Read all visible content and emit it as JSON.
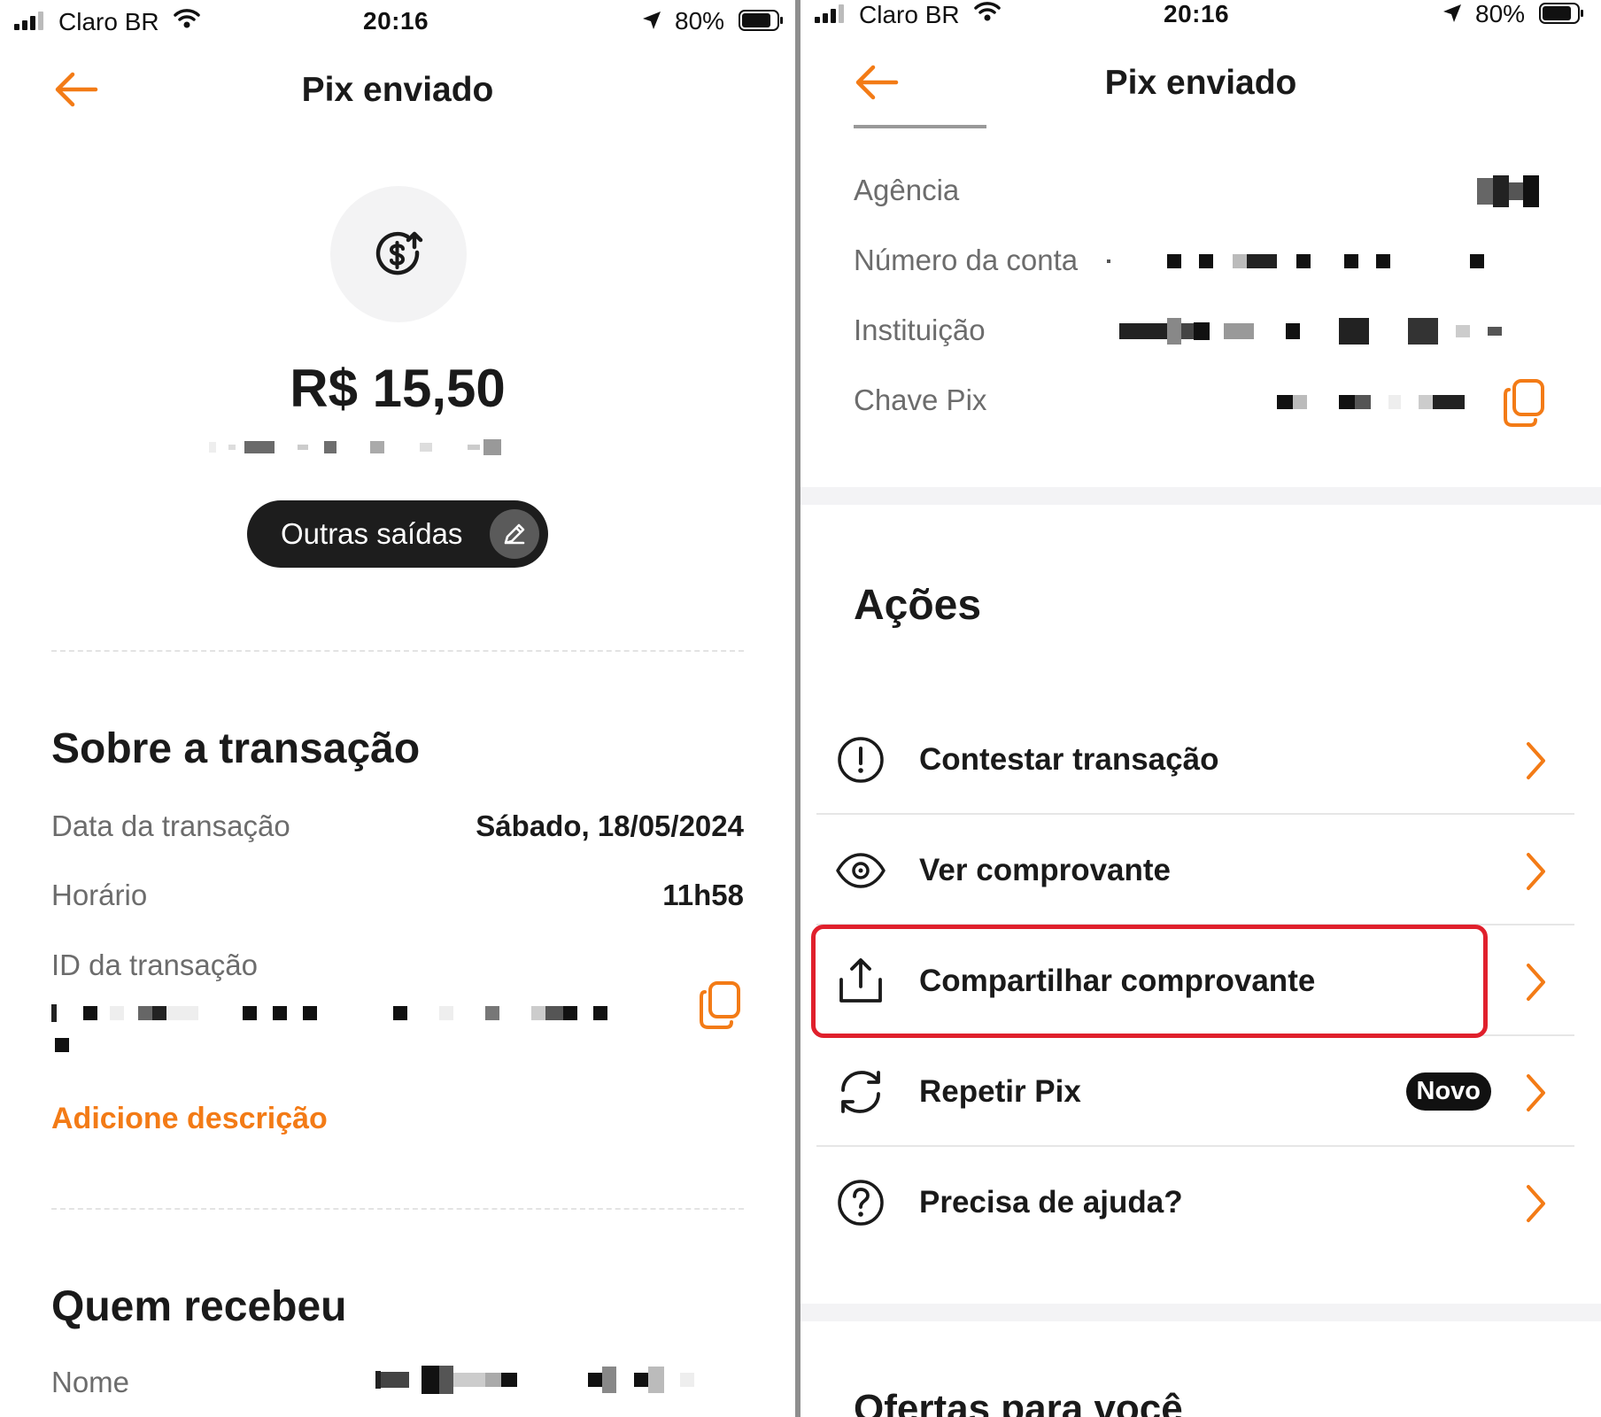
{
  "status_bar": {
    "carrier": "Claro BR",
    "time": "20:16",
    "battery": "80%"
  },
  "left": {
    "title": "Pix enviado",
    "amount": "R$ 15,50",
    "category_pill": "Outras saídas",
    "section_transaction": "Sobre a transação",
    "rows": {
      "date_label": "Data da transação",
      "date_value": "Sábado, 18/05/2024",
      "time_label": "Horário",
      "time_value": "11h58",
      "id_label": "ID da transação"
    },
    "add_description": "Adicione descrição",
    "section_receiver": "Quem recebeu",
    "name_label": "Nome"
  },
  "right": {
    "title": "Pix enviado",
    "rows": {
      "agency_label": "Agência",
      "account_label": "Número da conta",
      "institution_label": "Instituição",
      "pix_key_label": "Chave Pix"
    },
    "section_actions": "Ações",
    "actions": [
      {
        "label": "Contestar transação",
        "icon": "alert-circle-icon"
      },
      {
        "label": "Ver comprovante",
        "icon": "eye-icon"
      },
      {
        "label": "Compartilhar comprovante",
        "icon": "share-icon"
      },
      {
        "label": "Repetir Pix",
        "icon": "repeat-icon",
        "badge": "Novo"
      },
      {
        "label": "Precisa de ajuda?",
        "icon": "help-circle-icon"
      }
    ],
    "section_offers": "Ofertas para você"
  },
  "colors": {
    "accent": "#f37b16",
    "highlight": "#e0202c",
    "pill": "#1d1d1d"
  }
}
